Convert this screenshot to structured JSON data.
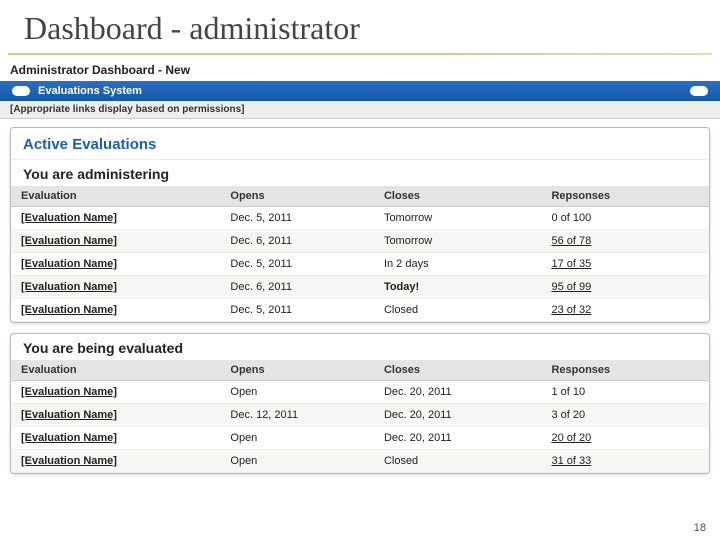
{
  "slide": {
    "title": "Dashboard - administrator"
  },
  "sysTitle": "Administrator Dashboard - New",
  "systemBar": {
    "label": "Evaluations System"
  },
  "permNote": "[Appropriate links display based on permissions]",
  "panel1": {
    "header": "Active Evaluations",
    "subheader": "You are administering",
    "columns": {
      "c1": "Evaluation",
      "c2": "Opens",
      "c3": "Closes",
      "c4": "Repsonses"
    },
    "rows": [
      {
        "name": "[Evaluation Name]",
        "opens": "Dec. 5, 2011",
        "closes": "Tomorrow",
        "responses": "0 of 100",
        "respLink": false,
        "today": false
      },
      {
        "name": "[Evaluation Name]",
        "opens": "Dec. 6, 2011",
        "closes": "Tomorrow",
        "responses": "56 of 78",
        "respLink": true,
        "today": false
      },
      {
        "name": "[Evaluation Name]",
        "opens": "Dec. 5, 2011",
        "closes": "In 2 days",
        "responses": "17 of 35",
        "respLink": true,
        "today": false
      },
      {
        "name": "[Evaluation Name]",
        "opens": "Dec. 6, 2011",
        "closes": "Today!",
        "responses": "95 of 99",
        "respLink": true,
        "today": true
      },
      {
        "name": "[Evaluation Name]",
        "opens": "Dec. 5, 2011",
        "closes": "Closed",
        "responses": "23 of 32",
        "respLink": true,
        "today": false
      }
    ]
  },
  "panel2": {
    "subheader": "You are being evaluated",
    "columns": {
      "c1": "Evaluation",
      "c2": "Opens",
      "c3": "Closes",
      "c4": "Responses"
    },
    "rows": [
      {
        "name": "[Evaluation Name]",
        "opens": "Open",
        "closes": "Dec. 20, 2011",
        "responses": "1 of 10",
        "respLink": false
      },
      {
        "name": "[Evaluation Name]",
        "opens": "Dec. 12, 2011",
        "closes": "Dec. 20, 2011",
        "responses": "3 of 20",
        "respLink": false
      },
      {
        "name": "[Evaluation Name]",
        "opens": "Open",
        "closes": "Dec. 20, 2011",
        "responses": "20 of 20",
        "respLink": true
      },
      {
        "name": "[Evaluation Name]",
        "opens": "Open",
        "closes": "Closed",
        "responses": "31 of 33",
        "respLink": true
      }
    ]
  },
  "pageNum": "18"
}
